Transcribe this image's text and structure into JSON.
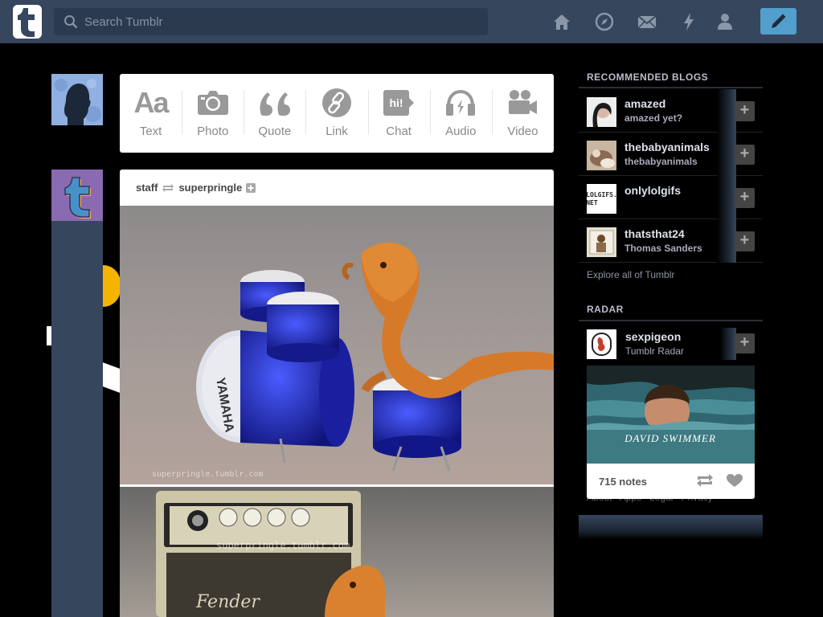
{
  "header": {
    "search_placeholder": "Search Tumblr",
    "nav_icons": [
      "home-icon",
      "explore-icon",
      "inbox-icon",
      "activity-icon",
      "account-icon"
    ],
    "compose_icon": "pencil-icon"
  },
  "post_types": [
    {
      "label": "Text",
      "icon": "text-icon"
    },
    {
      "label": "Photo",
      "icon": "camera-icon"
    },
    {
      "label": "Quote",
      "icon": "quote-icon"
    },
    {
      "label": "Link",
      "icon": "link-icon"
    },
    {
      "label": "Chat",
      "icon": "chat-icon",
      "glyph": "hi!"
    },
    {
      "label": "Audio",
      "icon": "headphones-icon"
    },
    {
      "label": "Video",
      "icon": "video-camera-icon"
    }
  ],
  "post": {
    "author": "staff",
    "reblogged_from": "superpringle",
    "watermark1": "superpringle.tumblr.com",
    "watermark2": "superpringle.tumblr.com"
  },
  "recommended": {
    "title": "RECOMMENDED BLOGS",
    "blogs": [
      {
        "name": "amazed",
        "subtitle": "amazed yet?"
      },
      {
        "name": "thebabyanimals",
        "subtitle": "thebabyanimals"
      },
      {
        "name": "onlylolgifs",
        "subtitle": "",
        "avatar_text": "LOLGIFS.\nNET"
      },
      {
        "name": "thatsthat24",
        "subtitle": "Thomas Sanders"
      }
    ],
    "explore_link": "Explore all of Tumblr"
  },
  "radar": {
    "title": "RADAR",
    "blog_name": "sexpigeon",
    "subtitle": "Tumblr Radar",
    "caption": "DAVID SWIMMER",
    "notes": "715 notes"
  },
  "footer": {
    "links": [
      "About",
      "Apps",
      "Legal",
      "Privacy"
    ]
  },
  "colors": {
    "header_bg": "#36465d",
    "compose_bg": "#529ecc",
    "page_bg": "#000000"
  }
}
